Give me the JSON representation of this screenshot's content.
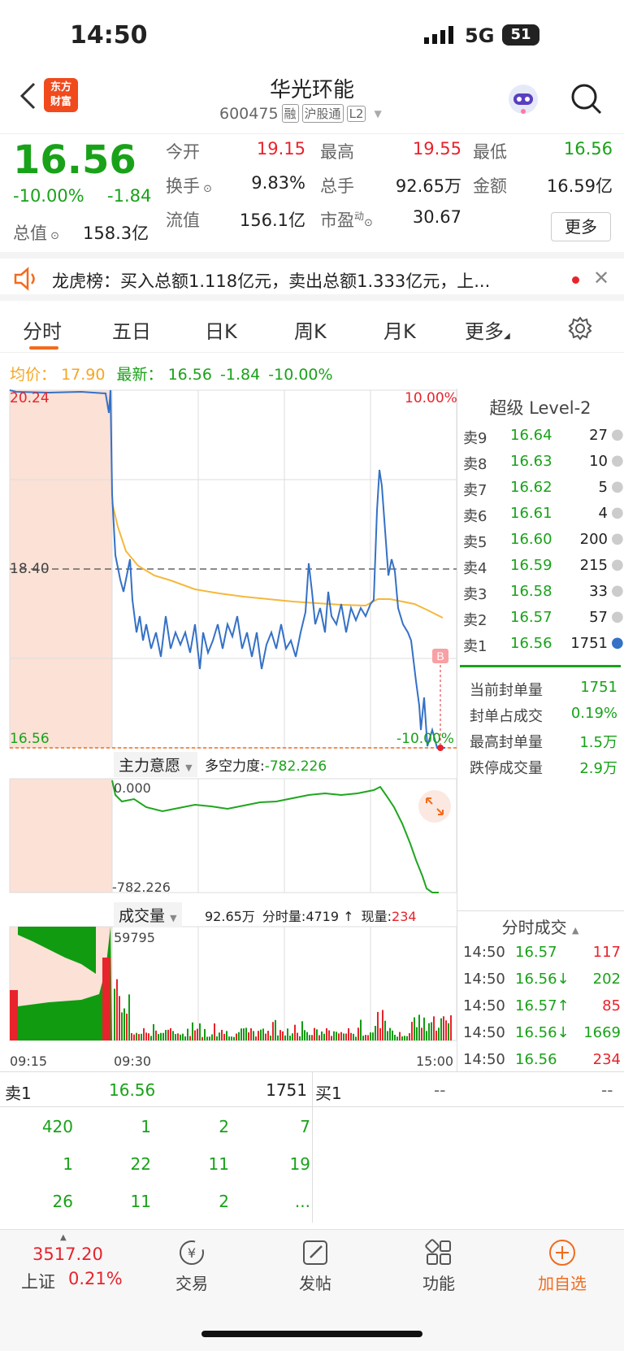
{
  "status": {
    "time": "14:50",
    "network": "5G",
    "battery": "51"
  },
  "header": {
    "logo_text": "东方\n财富",
    "logo_line1": "东方",
    "logo_line2": "财富",
    "title": "华光环能",
    "code": "600475",
    "tags": [
      "融",
      "沪股通",
      "L2"
    ]
  },
  "quote": {
    "price": "16.56",
    "change_pct": "-10.00%",
    "change": "-1.84",
    "fields": [
      {
        "label": "今开",
        "value": "19.15",
        "color": "#e8232c"
      },
      {
        "label": "最高",
        "value": "19.55",
        "color": "#e8232c"
      },
      {
        "label": "最低",
        "value": "16.56",
        "color": "#19a219"
      },
      {
        "label": "换手",
        "value": "9.83%",
        "color": "#222"
      },
      {
        "label": "总手",
        "value": "92.65万",
        "color": "#222"
      },
      {
        "label": "金额",
        "value": "16.59亿",
        "color": "#222"
      },
      {
        "label": "总值",
        "value": "158.3亿",
        "color": "#222"
      },
      {
        "label": "流值",
        "value": "156.1亿",
        "color": "#222"
      },
      {
        "label": "市盈",
        "value": "30.67",
        "color": "#222"
      }
    ],
    "more_label": "更多",
    "pe_sup": "动"
  },
  "notice": {
    "text": "龙虎榜：买入总额1.118亿元，卖出总额1.333亿元，上..."
  },
  "tabs": [
    "分时",
    "五日",
    "日K",
    "周K",
    "月K",
    "更多"
  ],
  "info_line": {
    "avg_label": "均价：",
    "avg_value": "17.90",
    "latest_label": "最新：",
    "latest_value": "16.56",
    "latest_change": "-1.84",
    "latest_pct": "-10.00%"
  },
  "price_chart": {
    "top_price": "20.24",
    "top_pct": "10.00%",
    "mid_price": "18.40",
    "bottom_price": "16.56",
    "bottom_pct": "-10.00%",
    "marker": "B"
  },
  "force_chart": {
    "label": "主力意愿",
    "desc_label": "多空力度:",
    "desc_value": "-782.226",
    "top": "0.000",
    "bottom": "-782.226"
  },
  "volume_chart": {
    "label": "成交量",
    "total": "92.65万",
    "fenshi_label": "分时量:",
    "fenshi_value": "4719 ↑",
    "now_label": "现量:",
    "now_value": "234",
    "max": "59795",
    "t_start": "09:15",
    "t_mid": "09:30",
    "t_end": "15:00"
  },
  "level2": {
    "title": "超级 Level-2",
    "asks": [
      {
        "label": "卖9",
        "price": "16.64",
        "vol": "27"
      },
      {
        "label": "卖8",
        "price": "16.63",
        "vol": "10"
      },
      {
        "label": "卖7",
        "price": "16.62",
        "vol": "5"
      },
      {
        "label": "卖6",
        "price": "16.61",
        "vol": "4"
      },
      {
        "label": "卖5",
        "price": "16.60",
        "vol": "200"
      },
      {
        "label": "卖4",
        "price": "16.59",
        "vol": "215"
      },
      {
        "label": "卖3",
        "price": "16.58",
        "vol": "33"
      },
      {
        "label": "卖2",
        "price": "16.57",
        "vol": "57"
      },
      {
        "label": "卖1",
        "price": "16.56",
        "vol": "1751"
      }
    ],
    "stats": [
      {
        "label": "当前封单量",
        "value": "1751"
      },
      {
        "label": "封单占成交",
        "value": "0.19%"
      },
      {
        "label": "最高封单量",
        "value": "1.5万"
      },
      {
        "label": "跌停成交量",
        "value": "2.9万"
      }
    ],
    "trades_title": "分时成交",
    "trades": [
      {
        "time": "14:50",
        "price": "16.57",
        "arrow": "",
        "vol": "117",
        "vcolor": "#e8232c"
      },
      {
        "time": "14:50",
        "price": "16.56↓",
        "arrow": "",
        "vol": "202",
        "vcolor": "#19a219"
      },
      {
        "time": "14:50",
        "price": "16.57↑",
        "arrow": "",
        "vol": "85",
        "vcolor": "#e8232c"
      },
      {
        "time": "14:50",
        "price": "16.56↓",
        "arrow": "",
        "vol": "1669",
        "vcolor": "#19a219"
      },
      {
        "time": "14:50",
        "price": "16.56",
        "arrow": "",
        "vol": "234",
        "vcolor": "#e8232c"
      }
    ]
  },
  "queue": {
    "sell_label": "卖1",
    "sell_price": "16.56",
    "sell_vol": "1751",
    "buy_label": "买1",
    "buy_price": "--",
    "buy_vol": "--",
    "rows": [
      [
        "420",
        "1",
        "2",
        "7"
      ],
      [
        "1",
        "22",
        "11",
        "19"
      ],
      [
        "26",
        "11",
        "2",
        "..."
      ]
    ]
  },
  "nav": {
    "index_value": "3517.20",
    "index_name": "上证",
    "index_pct": "0.21%",
    "items": [
      "交易",
      "发帖",
      "功能",
      "加自选"
    ]
  },
  "colors": {
    "up": "#e8232c",
    "down": "#19a219",
    "accent": "#f26b1d",
    "price_line": "#3571c6",
    "avg_line": "#f5b83b",
    "force_line": "#1fa61f"
  }
}
